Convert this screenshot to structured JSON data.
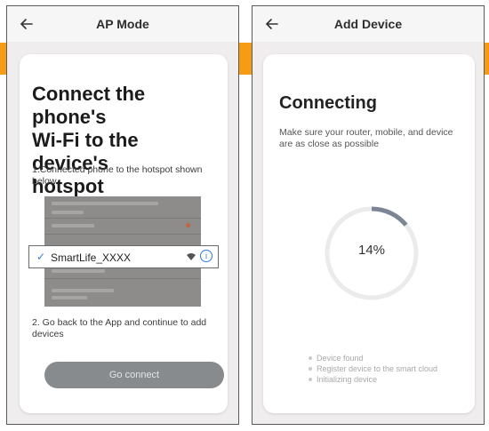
{
  "colors": {
    "accent_band": "#f59b14",
    "button_bg": "#888b8e",
    "progress_arc": "#7c8594",
    "check_blue": "#2b7de2"
  },
  "ap_screen": {
    "title": "AP Mode",
    "back_icon": "arrow-left-icon",
    "heading_line1": "Connect the phone's",
    "heading_line2": "Wi-Fi to the device's",
    "heading_line3": "hotspot",
    "step1": "1.Connected phone to the hotspot shown below",
    "network_name": "SmartLife_XXXX",
    "network_icons": [
      "check-icon",
      "wifi-icon",
      "info-icon"
    ],
    "step2": "2. Go back to the App and continue to add devices",
    "button_label": "Go connect"
  },
  "add_device_screen": {
    "title": "Add Device",
    "back_icon": "arrow-left-icon",
    "heading": "Connecting",
    "note": "Make sure your router, mobile, and device are as close as possible",
    "progress_percent": 14,
    "progress_label": "14%",
    "stages": [
      "Device found",
      "Register device to the smart cloud",
      "Initializing device"
    ]
  }
}
